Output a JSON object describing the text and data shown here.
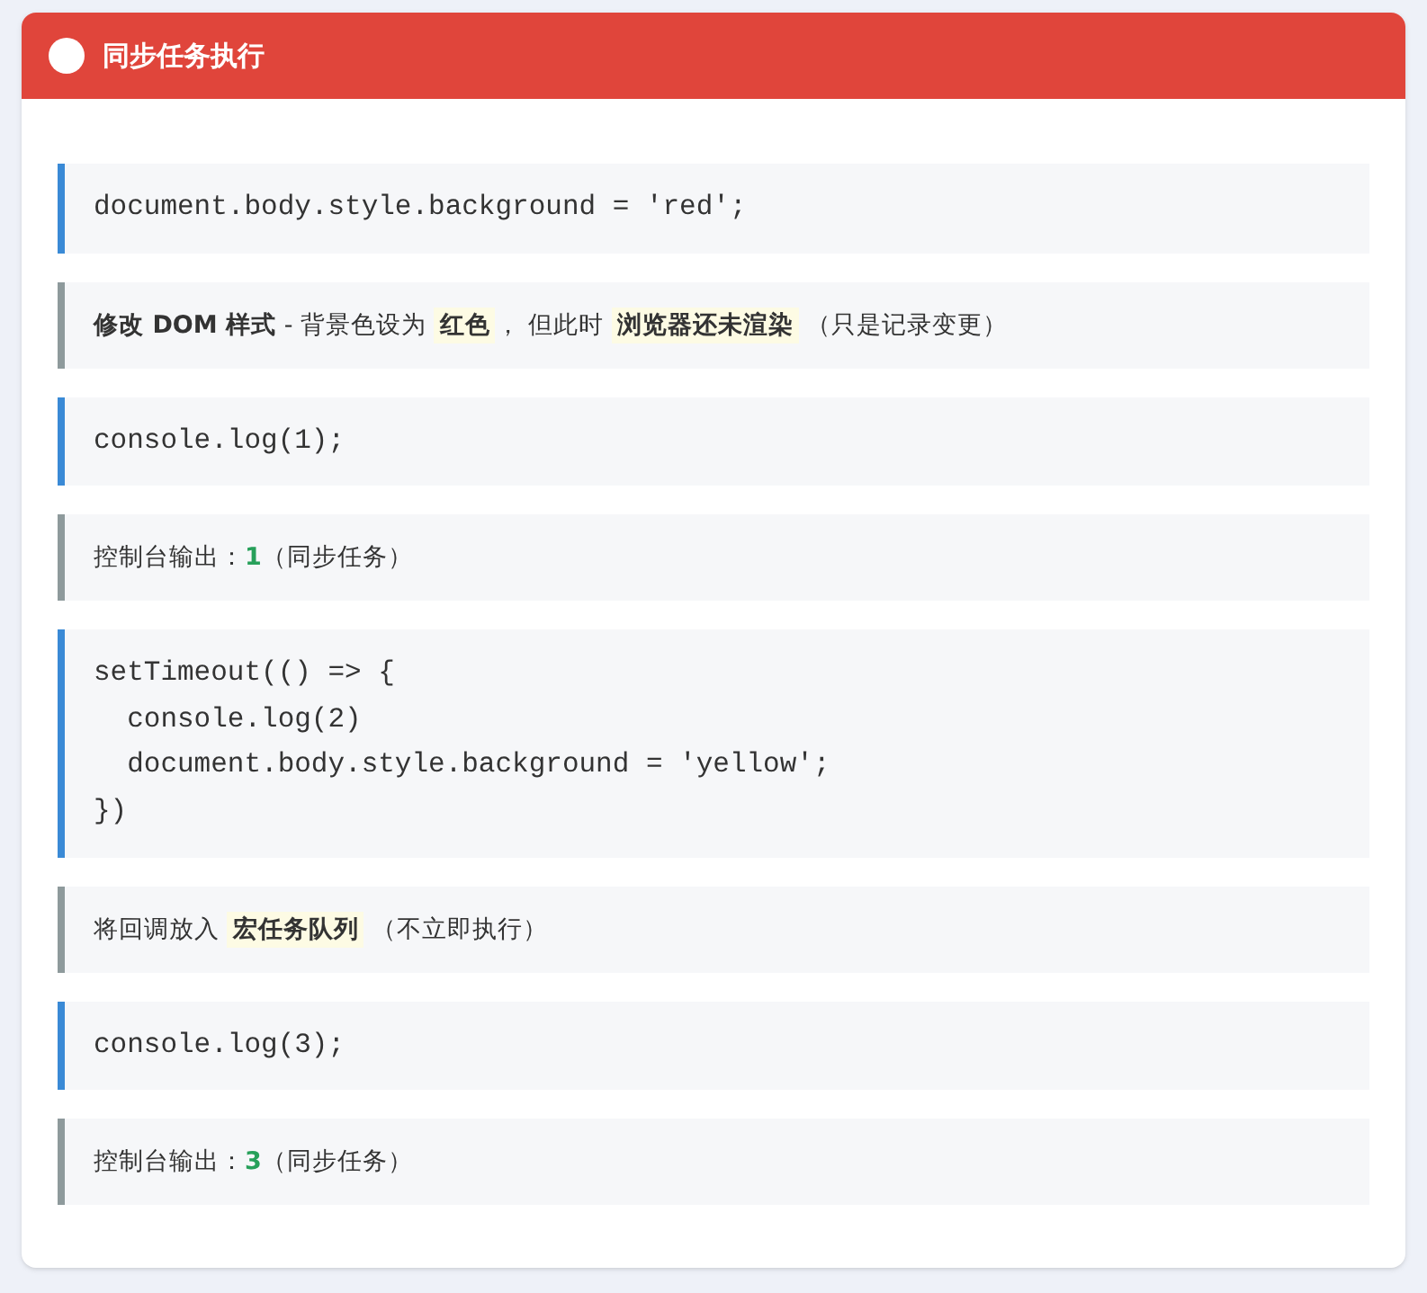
{
  "title": "同步任务执行",
  "steps": [
    {
      "kind": "code",
      "lines": [
        "document.body.style.background = 'red';"
      ]
    },
    {
      "kind": "note",
      "segments": [
        {
          "kind": "bold",
          "text": "修改 DOM 样式"
        },
        {
          "kind": "plain",
          "text": " - 背景色设为 "
        },
        {
          "kind": "highlight",
          "text": "红色"
        },
        {
          "kind": "plain",
          "text": "， 但此时 "
        },
        {
          "kind": "highlight",
          "text": "浏览器还未渲染"
        },
        {
          "kind": "plain",
          "text": " （只是记录变更）"
        }
      ]
    },
    {
      "kind": "code",
      "lines": [
        "console.log(1);"
      ]
    },
    {
      "kind": "note",
      "segments": [
        {
          "kind": "plain",
          "text": "控制台输出："
        },
        {
          "kind": "number",
          "text": "1"
        },
        {
          "kind": "plain",
          "text": "（同步任务）"
        }
      ]
    },
    {
      "kind": "code",
      "lines": [
        "setTimeout(() => {",
        "  console.log(2)",
        "  document.body.style.background = 'yellow';",
        "})"
      ]
    },
    {
      "kind": "note",
      "segments": [
        {
          "kind": "plain",
          "text": "将回调放入 "
        },
        {
          "kind": "highlight",
          "text": "宏任务队列"
        },
        {
          "kind": "plain",
          "text": " （不立即执行）"
        }
      ]
    },
    {
      "kind": "code",
      "lines": [
        "console.log(3);"
      ]
    },
    {
      "kind": "note",
      "segments": [
        {
          "kind": "plain",
          "text": "控制台输出："
        },
        {
          "kind": "number",
          "text": "3"
        },
        {
          "kind": "plain",
          "text": "（同步任务）"
        }
      ]
    }
  ]
}
